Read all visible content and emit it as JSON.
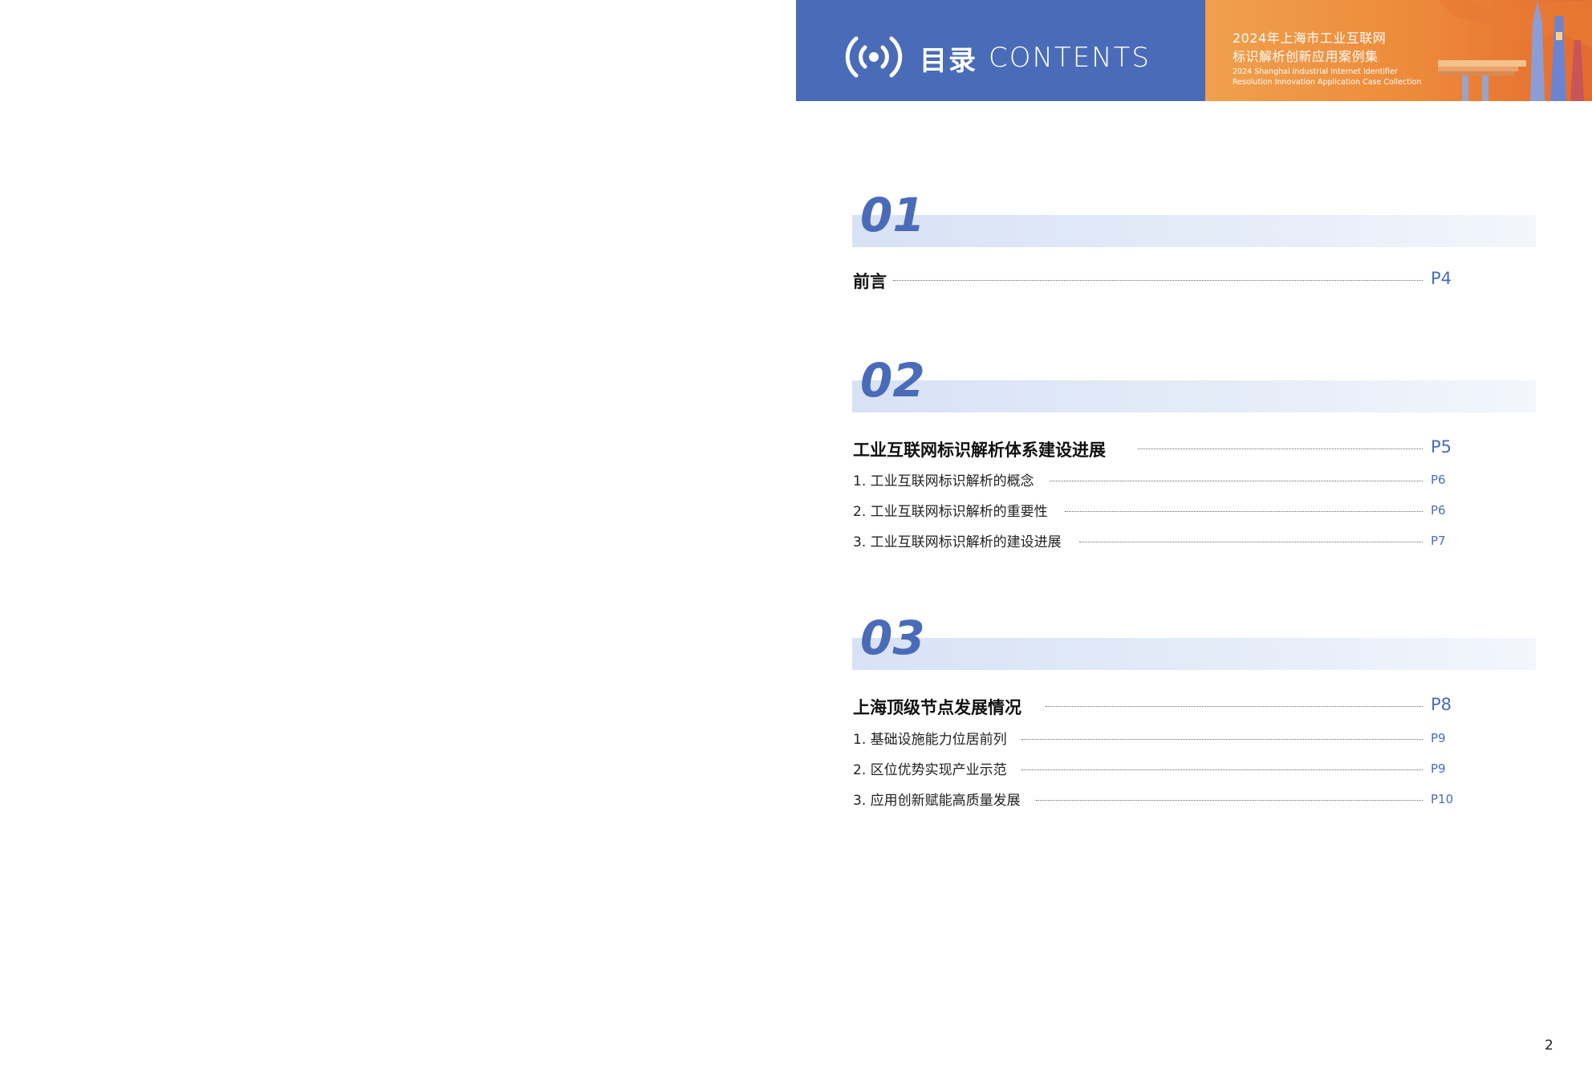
{
  "header": {
    "title_cn": "目录",
    "title_en": "CONTENTS",
    "icon": "broadcast-signal-icon",
    "banner_line1": "2024年上海市工业互联网",
    "banner_line2": "标识解析创新应用案例集",
    "banner_en_line1": "2024 Shanghai Industrial Internet Identifier",
    "banner_en_line2": "Resolution Innovation Application Case Collection"
  },
  "sections": [
    {
      "number": "01",
      "main": {
        "label": "前言",
        "page": "P4"
      },
      "items": []
    },
    {
      "number": "02",
      "main": {
        "label": "工业互联网标识解析体系建设进展",
        "page": "P5"
      },
      "items": [
        {
          "label": "1. 工业互联网标识解析的概念",
          "page": "P6"
        },
        {
          "label": "2. 工业互联网标识解析的重要性",
          "page": "P6"
        },
        {
          "label": "3. 工业互联网标识解析的建设进展",
          "page": "P7"
        }
      ]
    },
    {
      "number": "03",
      "main": {
        "label": "上海顶级节点发展情况",
        "page": "P8"
      },
      "items": [
        {
          "label": "1. 基础设施能力位居前列",
          "page": "P9"
        },
        {
          "label": "2. 区位优势实现产业示范",
          "page": "P9"
        },
        {
          "label": "3. 应用创新赋能高质量发展",
          "page": "P10"
        }
      ]
    }
  ],
  "page_number": "2",
  "colors": {
    "accent": "#4a6cb8",
    "banner_orange": "#ed8a3a"
  }
}
